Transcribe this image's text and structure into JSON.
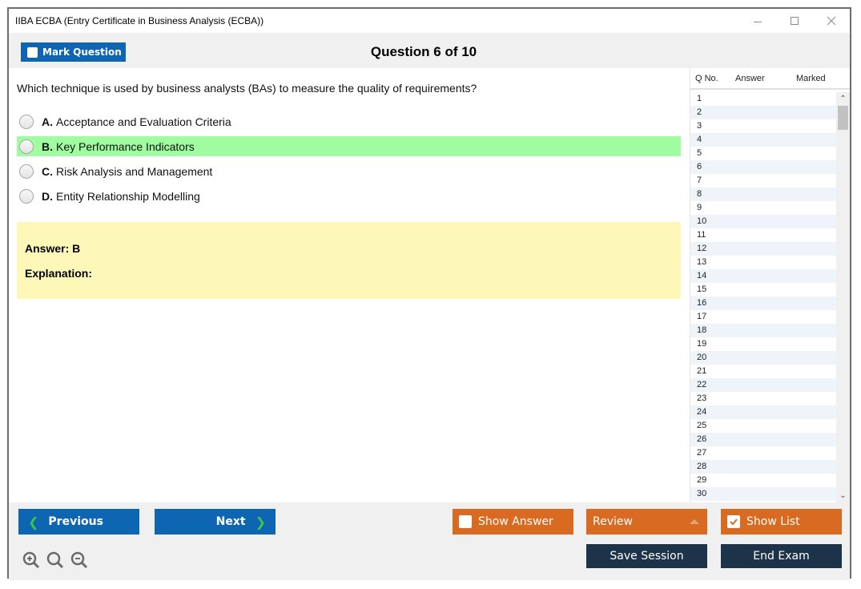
{
  "window": {
    "title": "IIBA ECBA (Entry Certificate in Business Analysis (ECBA))",
    "controls": {
      "minimize": "minimize-icon",
      "maximize": "maximize-icon",
      "close": "close-icon"
    }
  },
  "topbar": {
    "mark_question_label": "Mark Question",
    "mark_question_checked": false,
    "question_counter": "Question 6 of 10"
  },
  "question": {
    "text": "Which technique is used by business analysts (BAs) to measure the quality of requirements?",
    "options": [
      {
        "letter": "A.",
        "text": "Acceptance and Evaluation Criteria",
        "correct": false
      },
      {
        "letter": "B.",
        "text": "Key Performance Indicators",
        "correct": true
      },
      {
        "letter": "C.",
        "text": "Risk Analysis and Management",
        "correct": false
      },
      {
        "letter": "D.",
        "text": "Entity Relationship Modelling",
        "correct": false
      }
    ],
    "correct_highlight_color": "#a0fca0"
  },
  "answer_panel": {
    "answer_label": "Answer: B",
    "explanation_label": "Explanation:",
    "background_color": "#fdf8b8"
  },
  "question_list": {
    "headers": [
      "Q No.",
      "Answer",
      "Marked"
    ],
    "rows": [
      "1",
      "2",
      "3",
      "4",
      "5",
      "6",
      "7",
      "8",
      "9",
      "10",
      "11",
      "12",
      "13",
      "14",
      "15",
      "16",
      "17",
      "18",
      "19",
      "20",
      "21",
      "22",
      "23",
      "24",
      "25",
      "26",
      "27",
      "28",
      "29",
      "30"
    ]
  },
  "bottombar": {
    "previous_label": "Previous",
    "next_label": "Next",
    "show_answer_label": "Show Answer",
    "show_answer_checked": false,
    "review_label": "Review",
    "show_list_label": "Show List",
    "show_list_checked": true,
    "save_session_label": "Save Session",
    "end_exam_label": "End Exam",
    "zoom_icons": [
      "zoom-in-icon",
      "zoom-reset-icon",
      "zoom-out-icon"
    ]
  },
  "colors": {
    "primary_blue": "#0e66b3",
    "accent_orange": "#d86a22",
    "dark_navy": "#1c3349",
    "chevron_green": "#3fc43f"
  }
}
